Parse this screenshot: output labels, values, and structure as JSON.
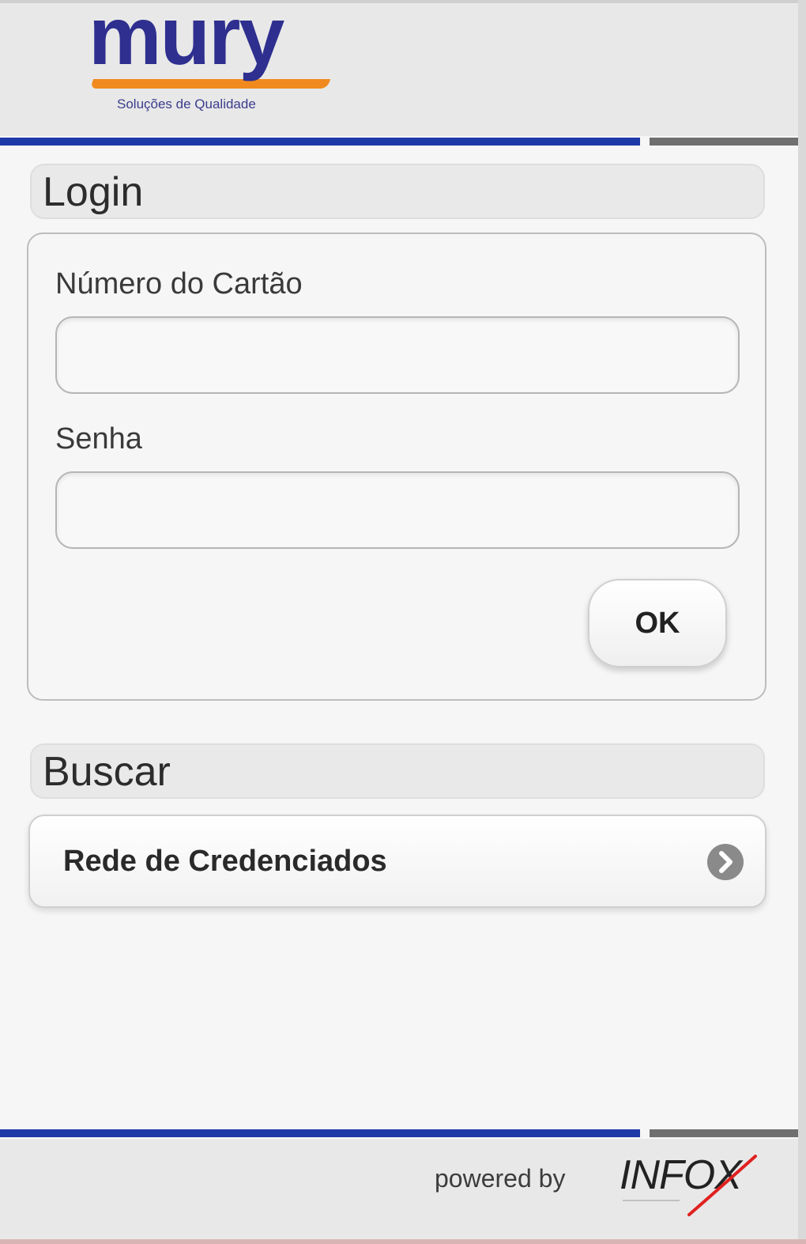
{
  "header": {
    "logo_text": "mury",
    "logo_tagline": "Soluções de Qualidade"
  },
  "login": {
    "title": "Login",
    "card_label": "Número do Cartão",
    "card_value": "",
    "password_label": "Senha",
    "password_value": "",
    "ok_label": "OK"
  },
  "search": {
    "title": "Buscar",
    "items": [
      {
        "label": "Rede de Credenciados",
        "icon": "chevron-right-icon"
      }
    ]
  },
  "footer": {
    "powered_by": "powered by",
    "brand": "INFOX"
  },
  "colors": {
    "brand_blue": "#2e2f8f",
    "brand_orange": "#f18a1e",
    "divider_blue": "#1e3aa8",
    "divider_gray": "#6f6f6f",
    "infox_red": "#e02020"
  }
}
